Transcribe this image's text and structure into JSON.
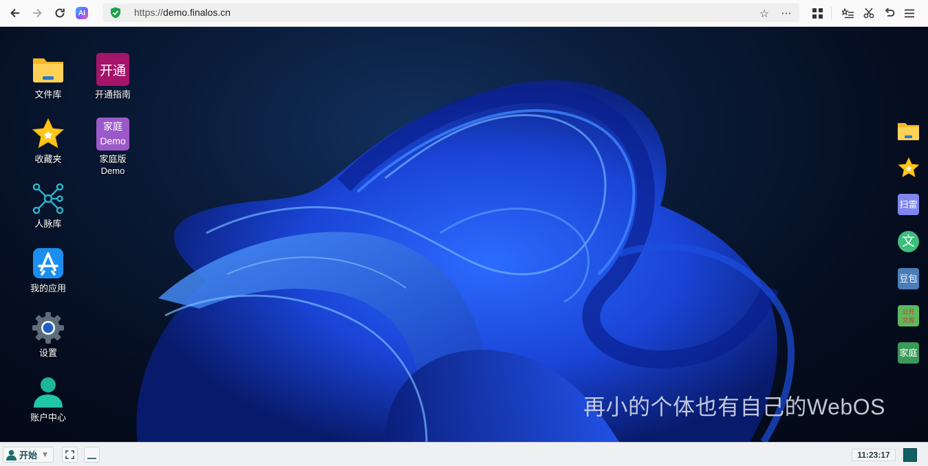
{
  "browser": {
    "url_scheme": "https://",
    "url_host": "demo.finalos.cn",
    "ai_badge": "AI"
  },
  "desktop": {
    "icons": [
      {
        "label": "文件库",
        "icon": "folder-icon"
      },
      {
        "label": "收藏夹",
        "icon": "star-icon"
      },
      {
        "label": "人脉库",
        "icon": "network-icon"
      },
      {
        "label": "我的应用",
        "icon": "app-store-icon"
      },
      {
        "label": "设置",
        "icon": "gear-icon"
      },
      {
        "label": "账户中心",
        "icon": "user-icon"
      }
    ],
    "icons_col2": [
      {
        "label": "开通指南",
        "tile_text": "开通",
        "color": "#a4146a"
      },
      {
        "label_line1": "家庭版",
        "label_line2": "Demo",
        "tile_line1": "家庭",
        "tile_line2": "Demo",
        "color": "#9b59c9"
      }
    ],
    "slogan": "再小的个体也有自己的WebOS"
  },
  "dock": [
    {
      "icon": "folder-icon"
    },
    {
      "icon": "star-icon"
    },
    {
      "text": "扫雷",
      "color": "#7f86ee"
    },
    {
      "text": "文",
      "color": "#3cbf7a"
    },
    {
      "text": "豆包",
      "color": "#4a7db8"
    },
    {
      "text_line1": "公开",
      "text_line2": "文库",
      "color": "#5cb85c",
      "text_color": "#d9332b"
    },
    {
      "text": "家庭",
      "color": "#3a9a5a"
    }
  ],
  "taskbar": {
    "start_label": "开始",
    "clock": "11:23:17",
    "accent": "#135f63"
  }
}
